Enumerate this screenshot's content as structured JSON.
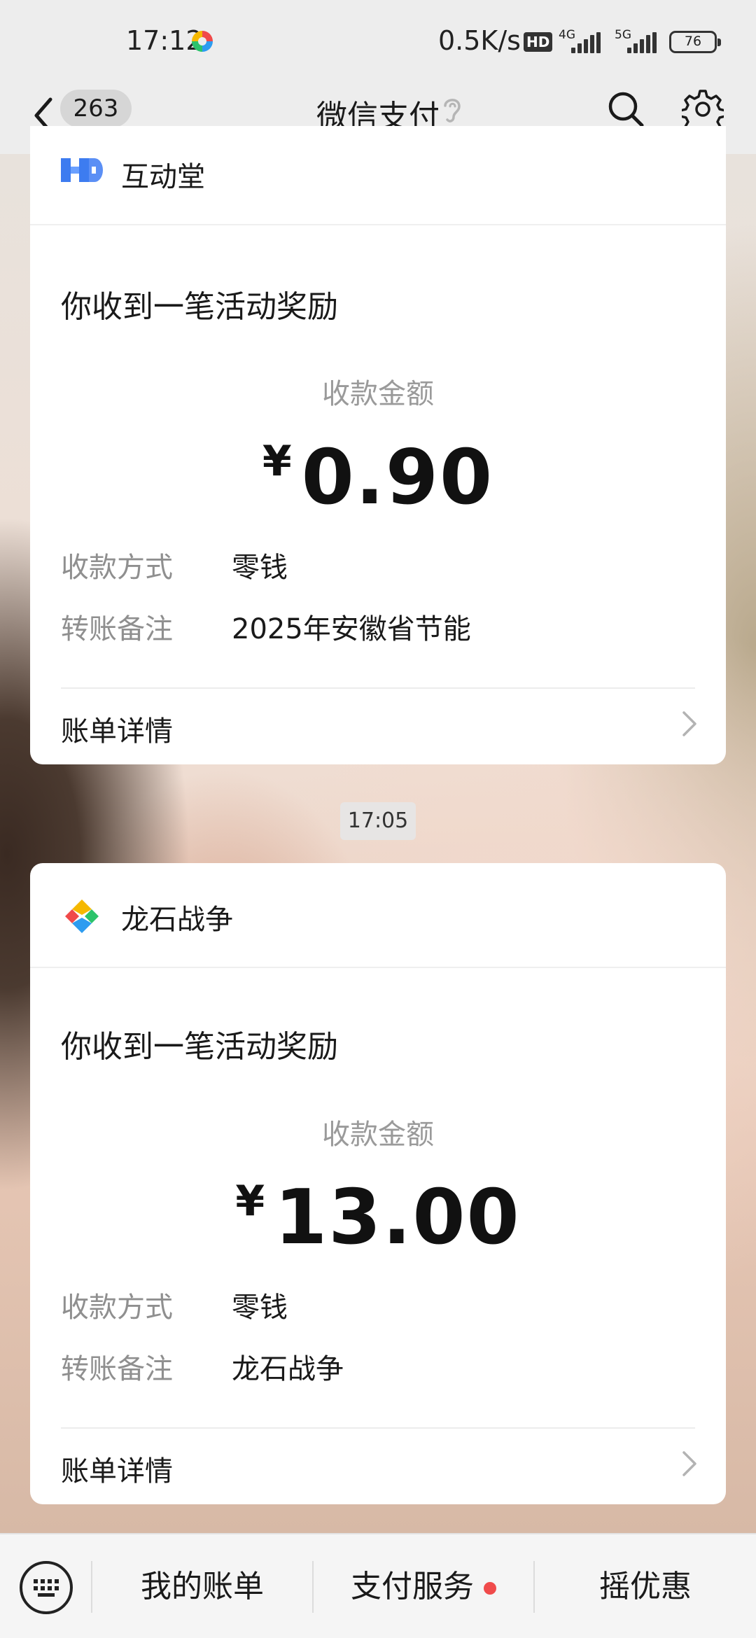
{
  "status_bar": {
    "time": "17:12",
    "net_speed": "0.5K/s",
    "hd_label": "HD",
    "net_4g": "4G",
    "net_5g": "5G",
    "battery": "76"
  },
  "nav": {
    "unread_count": "263",
    "title": "微信支付"
  },
  "messages": [
    {
      "brand": "互动堂",
      "subject": "你收到一笔活动奖励",
      "amount_label": "收款金额",
      "currency": "¥",
      "amount": "0.90",
      "method_label": "收款方式",
      "method_value": "零钱",
      "note_label": "转账备注",
      "note_value": "2025年安徽省节能",
      "detail_label": "账单详情"
    },
    {
      "time": "17:05",
      "brand": "龙石战争",
      "subject": "你收到一笔活动奖励",
      "amount_label": "收款金额",
      "currency": "¥",
      "amount": "13.00",
      "method_label": "收款方式",
      "method_value": "零钱",
      "note_label": "转账备注",
      "note_value": "龙石战争",
      "detail_label": "账单详情"
    }
  ],
  "bottom_menu": {
    "items": [
      "我的账单",
      "支付服务",
      "摇优惠"
    ],
    "has_notification_dot": true
  },
  "colors": {
    "accent_red": "#f04b4b",
    "brand_blue": "#3d7cf0"
  },
  "icons": [
    "back-icon",
    "ear-icon",
    "search-icon",
    "gear-icon",
    "keyboard-icon",
    "chevron-right-icon"
  ]
}
